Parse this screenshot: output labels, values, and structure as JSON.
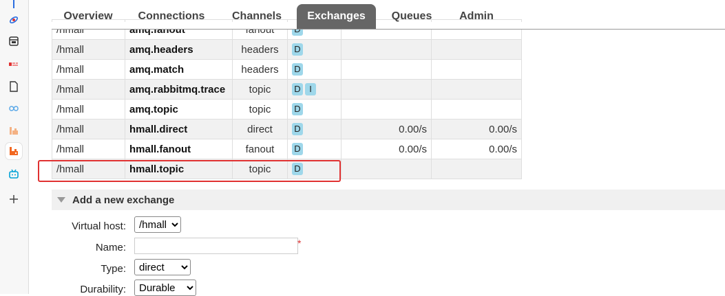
{
  "sidebar": {
    "icons": [
      "pin-icon",
      "rocket-icon",
      "window-icon",
      "grid-icon",
      "document-icon",
      "infinity-icon",
      "bars-icon",
      "rabbitmq-icon",
      "tv-icon",
      "plus-icon"
    ]
  },
  "tabs": [
    "Overview",
    "Connections",
    "Channels",
    "Exchanges",
    "Queues",
    "Admin"
  ],
  "active_tab": "Exchanges",
  "table": {
    "rows": [
      {
        "vhost": "/hmall",
        "name": "amq.fanout",
        "type": "fanout",
        "features": [
          "D"
        ],
        "rate_in": "",
        "rate_out": ""
      },
      {
        "vhost": "/hmall",
        "name": "amq.headers",
        "type": "headers",
        "features": [
          "D"
        ],
        "rate_in": "",
        "rate_out": ""
      },
      {
        "vhost": "/hmall",
        "name": "amq.match",
        "type": "headers",
        "features": [
          "D"
        ],
        "rate_in": "",
        "rate_out": ""
      },
      {
        "vhost": "/hmall",
        "name": "amq.rabbitmq.trace",
        "type": "topic",
        "features": [
          "D",
          "I"
        ],
        "rate_in": "",
        "rate_out": ""
      },
      {
        "vhost": "/hmall",
        "name": "amq.topic",
        "type": "topic",
        "features": [
          "D"
        ],
        "rate_in": "",
        "rate_out": ""
      },
      {
        "vhost": "/hmall",
        "name": "hmall.direct",
        "type": "direct",
        "features": [
          "D"
        ],
        "rate_in": "0.00/s",
        "rate_out": "0.00/s"
      },
      {
        "vhost": "/hmall",
        "name": "hmall.fanout",
        "type": "fanout",
        "features": [
          "D"
        ],
        "rate_in": "0.00/s",
        "rate_out": "0.00/s"
      },
      {
        "vhost": "/hmall",
        "name": "hmall.topic",
        "type": "topic",
        "features": [
          "D"
        ],
        "rate_in": "",
        "rate_out": ""
      }
    ]
  },
  "add_exchange": {
    "title": "Add a new exchange",
    "virtual_host_label": "Virtual host:",
    "virtual_host_value": "/hmall",
    "name_label": "Name:",
    "name_value": "",
    "required_mark": "*",
    "type_label": "Type:",
    "type_value": "direct",
    "durability_label": "Durability:",
    "durability_value": "Durable"
  }
}
